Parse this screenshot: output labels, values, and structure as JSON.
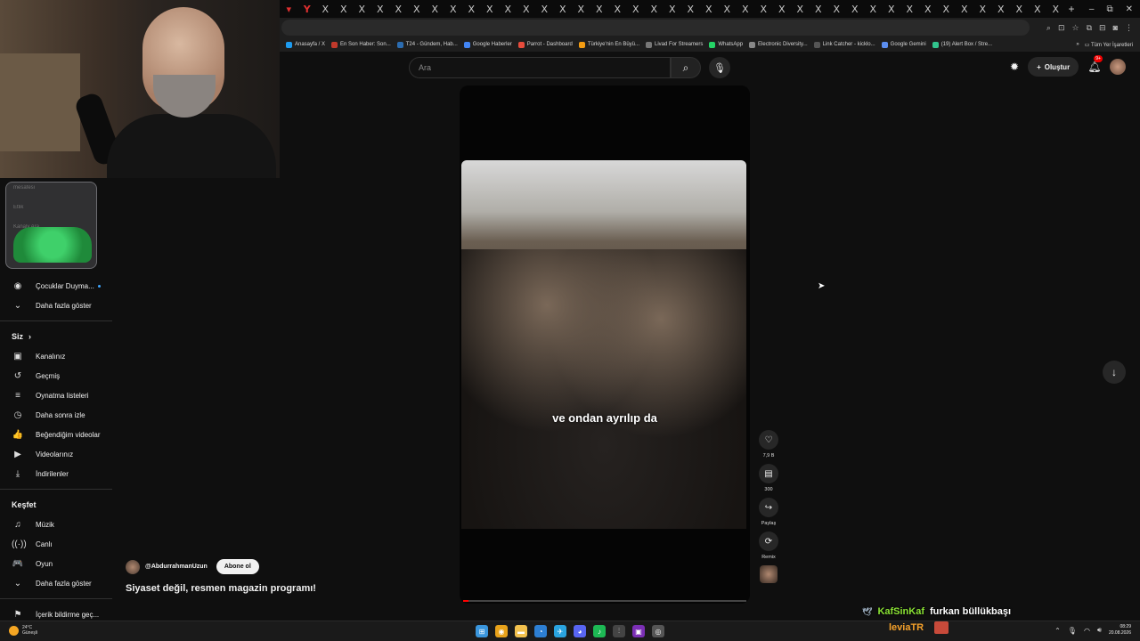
{
  "browser": {
    "tab_glyphs": [
      "▾",
      "Y",
      "X",
      "X",
      "X",
      "X",
      "X",
      "X",
      "X",
      "X",
      "X",
      "X",
      "X",
      "X",
      "X",
      "X",
      "X",
      "X",
      "X",
      "X",
      "X",
      "X",
      "X",
      "X",
      "X",
      "X",
      "X",
      "X",
      "X",
      "X",
      "X",
      "X",
      "X",
      "X",
      "X",
      "X",
      "X",
      "X",
      "X",
      "X",
      "X",
      "X",
      "X"
    ],
    "new_tab": "+",
    "window_controls": [
      "–",
      "⧉",
      "✕"
    ],
    "bookmarks": [
      {
        "label": "Anasayfa / X",
        "color": "#1d9bf0"
      },
      {
        "label": "En Son Haber: Son...",
        "color": "#c0392b"
      },
      {
        "label": "T24 - Gündem, Hab...",
        "color": "#2b6cb0"
      },
      {
        "label": "Google Haberler",
        "color": "#4285f4"
      },
      {
        "label": "Parrot - Dashboard",
        "color": "#e74c3c"
      },
      {
        "label": "Türkiye'nin En Büyü...",
        "color": "#f39c12"
      },
      {
        "label": "Livad For Streamers",
        "color": "#777777"
      },
      {
        "label": "WhatsApp",
        "color": "#25d366"
      },
      {
        "label": "Electronic Diversity...",
        "color": "#888888"
      },
      {
        "label": "Link Catcher - kicklo...",
        "color": "#555555"
      },
      {
        "label": "Google Gemini",
        "color": "#5b8def"
      },
      {
        "label": "(19) Alert Box / Stre...",
        "color": "#31c48d"
      }
    ],
    "bookmarks_overflow": "»",
    "all_bookmarks": "Tüm Yer İşaretleri"
  },
  "header": {
    "search_placeholder": "Ara",
    "search_icon": "⌕",
    "mic_icon": "🎙",
    "create_label": "Oluştur",
    "create_icon": "+",
    "notification_badge": "9+"
  },
  "bowl": {
    "ghost_items": [
      "mesafesi",
      "Etlik",
      "Kanaly Ara"
    ]
  },
  "sidebar": {
    "top_items": [
      {
        "icon": "◉",
        "label": "Çocuklar Duyma..."
      },
      {
        "icon": "⌄",
        "label": "Daha fazla göster"
      }
    ],
    "you_title": "Siz",
    "you_items": [
      {
        "icon": "▣",
        "label": "Kanalınız"
      },
      {
        "icon": "↺",
        "label": "Geçmiş"
      },
      {
        "icon": "≡",
        "label": "Oynatma listeleri"
      },
      {
        "icon": "◷",
        "label": "Daha sonra izle"
      },
      {
        "icon": "👍",
        "label": "Beğendiğim videolar"
      },
      {
        "icon": "▶",
        "label": "Videolarınız"
      },
      {
        "icon": "⤓",
        "label": "İndirilenler"
      }
    ],
    "explore_title": "Keşfet",
    "explore_items": [
      {
        "icon": "♫",
        "label": "Müzik"
      },
      {
        "icon": "((·))",
        "label": "Canlı"
      },
      {
        "icon": "🎮",
        "label": "Oyun"
      },
      {
        "icon": "⌄",
        "label": "Daha fazla göster"
      }
    ],
    "bottom_items": [
      {
        "icon": "⚑",
        "label": "İçerik bildirme geç..."
      }
    ]
  },
  "short": {
    "subtitle": "ve ondan ayrılıp da",
    "progress": 0.02,
    "channel": "@AbdurrahmanUzun",
    "subscribe_label": "Abone ol",
    "title": "Siyaset değil, resmen magazin programı!",
    "actions": [
      {
        "name": "like",
        "icon": "♡",
        "label": "7,9 B"
      },
      {
        "name": "comments",
        "icon": "▤",
        "label": "300"
      },
      {
        "name": "share",
        "icon": "↪",
        "label": "Paylaş"
      },
      {
        "name": "remix",
        "icon": "⟳",
        "label": "Remix"
      }
    ],
    "next_icon": "↓"
  },
  "stream": {
    "nickname": "KafSinKaf",
    "display_name": "furkan büllükbaşı",
    "brand": "leviaTR"
  },
  "taskbar": {
    "weather_temp": "24°C",
    "weather_desc": "Güneşli",
    "apps": [
      {
        "name": "start",
        "glyph": "⊞",
        "color": "#3a96dd"
      },
      {
        "name": "chrome",
        "glyph": "◉",
        "color": "#e8a21a"
      },
      {
        "name": "explorer",
        "glyph": "▬",
        "color": "#f2c14e"
      },
      {
        "name": "edge",
        "glyph": "◔",
        "color": "#2d7fd3"
      },
      {
        "name": "telegram",
        "glyph": "✈",
        "color": "#2aa3df"
      },
      {
        "name": "discord",
        "glyph": "◕",
        "color": "#5865f2"
      },
      {
        "name": "spotify",
        "glyph": "♪",
        "color": "#1db954"
      },
      {
        "name": "media",
        "glyph": "⫶",
        "color": "#444444"
      },
      {
        "name": "next",
        "glyph": "▣",
        "color": "#7b2fb5"
      },
      {
        "name": "obs",
        "glyph": "◎",
        "color": "#555555"
      }
    ],
    "time": "08:29",
    "date": "20.08.2026"
  }
}
